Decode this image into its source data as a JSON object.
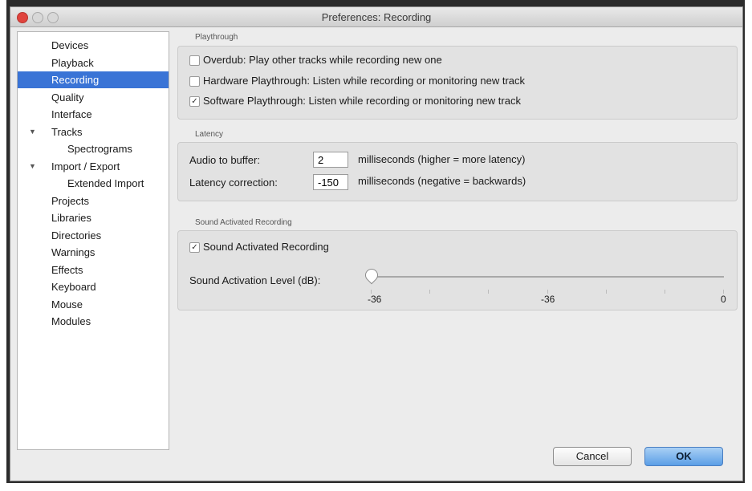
{
  "window": {
    "title": "Preferences: Recording"
  },
  "sidebar": {
    "items": [
      {
        "label": "Devices"
      },
      {
        "label": "Playback"
      },
      {
        "label": "Recording",
        "selected": true
      },
      {
        "label": "Quality"
      },
      {
        "label": "Interface"
      },
      {
        "label": "Tracks",
        "disclosure": "▼"
      },
      {
        "label": "Spectrograms",
        "indent": true
      },
      {
        "label": "Import / Export",
        "disclosure": "▼"
      },
      {
        "label": "Extended Import",
        "indent": true
      },
      {
        "label": "Projects"
      },
      {
        "label": "Libraries"
      },
      {
        "label": "Directories"
      },
      {
        "label": "Warnings"
      },
      {
        "label": "Effects"
      },
      {
        "label": "Keyboard"
      },
      {
        "label": "Mouse"
      },
      {
        "label": "Modules"
      }
    ]
  },
  "playthrough": {
    "section_label": "Playthrough",
    "overdub": {
      "label": "Overdub: Play other tracks while recording new one",
      "checked": false
    },
    "hardware": {
      "label": "Hardware Playthrough: Listen while recording or monitoring new track",
      "checked": false
    },
    "software": {
      "label": "Software Playthrough: Listen while recording or monitoring new track",
      "checked": true
    }
  },
  "latency": {
    "section_label": "Latency",
    "buffer_label": "Audio to buffer:",
    "buffer_value": "2",
    "buffer_units": "milliseconds (higher = more latency)",
    "correction_label": "Latency correction:",
    "correction_value": "-150",
    "correction_units": "milliseconds (negative = backwards)"
  },
  "sound_activated": {
    "section_label": "Sound Activated Recording",
    "checkbox_label": "Sound Activated Recording",
    "checked": true,
    "level_label": "Sound Activation Level (dB):",
    "level_value": -36,
    "slider_min": -60,
    "slider_max": 0,
    "tick_labels": [
      "-36",
      "-36",
      "0"
    ]
  },
  "buttons": {
    "cancel": "Cancel",
    "ok": "OK"
  },
  "icons": {
    "checkmark": "check-icon",
    "disclosure": "disclosure-triangle-icon"
  },
  "colors": {
    "selection": "#3a74d6",
    "close_button": "#e0443e",
    "ok_button": "#5b9ee6"
  }
}
